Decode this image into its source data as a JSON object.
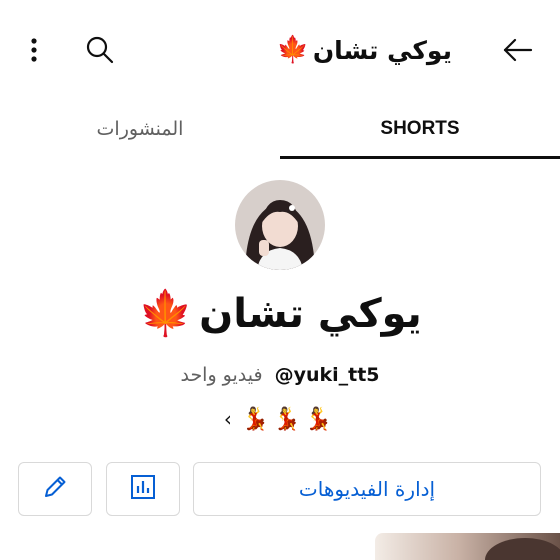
{
  "header": {
    "title": "يوكي تشان",
    "title_emoji": "🍁"
  },
  "tabs": [
    {
      "label": "SHORTS",
      "active": true
    },
    {
      "label": "المنشورات",
      "active": false
    }
  ],
  "channel": {
    "name": "يوكي تشان",
    "name_emoji": "🍁",
    "handle": "@yuki_tt5",
    "video_count": "فيديو واحد",
    "description_emojis": "💃💃💃",
    "description_more": "‹"
  },
  "actions": {
    "manage_videos_label": "إدارة الفيديوهات"
  },
  "colors": {
    "accent": "#065fd4",
    "text_primary": "#0f0f0f",
    "text_secondary": "#606060",
    "border": "#d9d9d9"
  }
}
